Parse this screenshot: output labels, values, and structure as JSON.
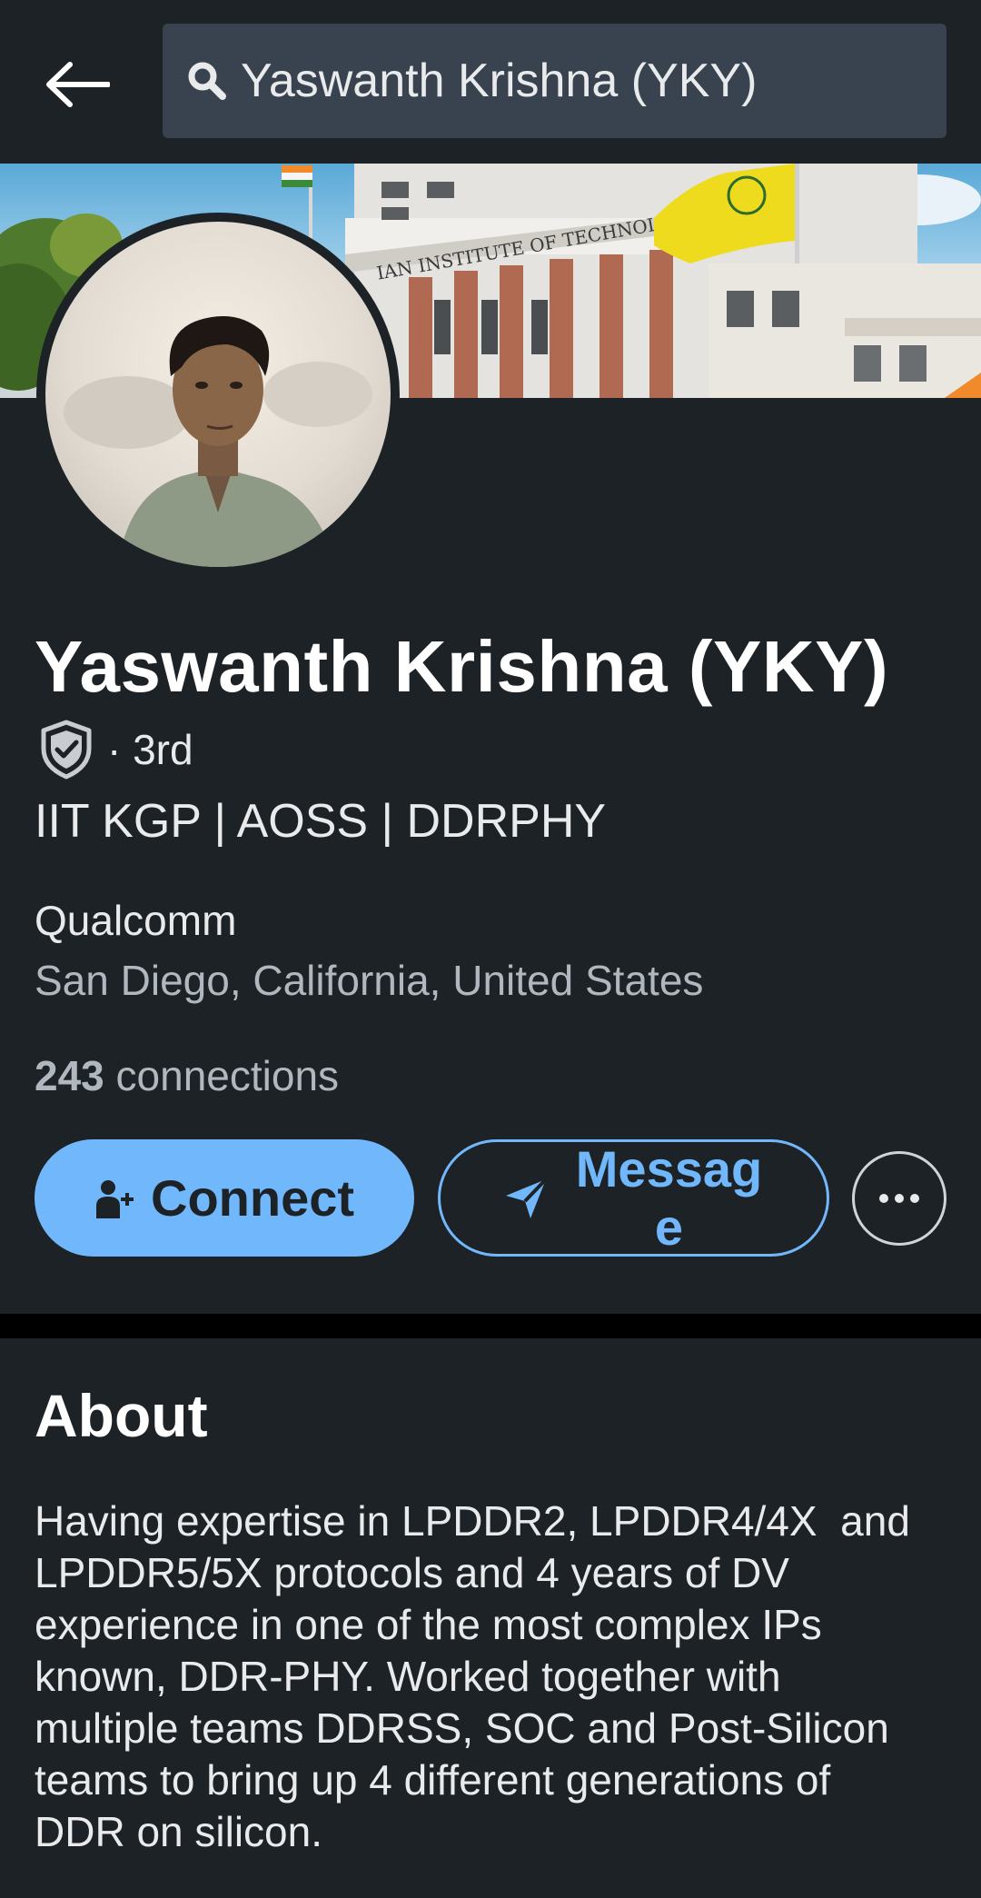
{
  "header": {
    "back_label": "Back",
    "search_value": "Yaswanth Krishna (YKY)"
  },
  "banner": {
    "building_sign": "IAN INSTITUTE OF TECHNOLOGY"
  },
  "profile": {
    "name": "Yaswanth Krishna (YKY)",
    "degree": "· 3rd",
    "headline": "IIT KGP | AOSS | DDRPHY",
    "company": "Qualcomm",
    "location": "San Diego, California, United States",
    "connections_count": "243",
    "connections_label": " connections"
  },
  "actions": {
    "connect_label": "Connect",
    "message_label": "Message",
    "more_label": "More"
  },
  "about": {
    "title": "About",
    "text": "Having expertise in LPDDR2, LPDDR4/4X  and\nLPDDR5/5X protocols and 4 years of DV\nexperience in one of the most complex IPs\nknown, DDR-PHY. Worked together with\nmultiple teams DDRSS, SOC and Post-Silicon\nteams to bring up 4 different generations of\nDDR on silicon."
  },
  "icons": {
    "back": "arrow-left-icon",
    "search": "search-icon",
    "verify": "shield-check-icon",
    "connect": "add-person-icon",
    "message": "send-icon",
    "more": "ellipsis-icon"
  },
  "colors": {
    "background": "#1d2226",
    "search_bg": "#38434f",
    "accent": "#71b7fb",
    "secondary_text": "#b0b7bf"
  }
}
